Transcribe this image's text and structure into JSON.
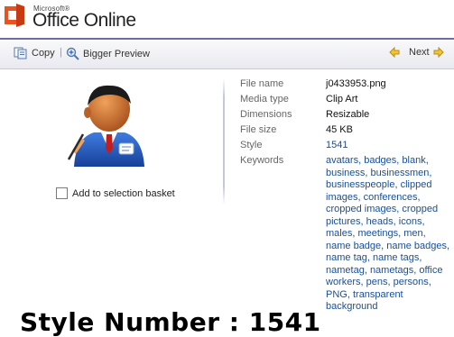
{
  "header": {
    "logo_small": "Microsoft®",
    "logo_title": "Office Online"
  },
  "toolbar": {
    "copy_label": "Copy",
    "separator": "|",
    "bigger_preview_label": "Bigger Preview",
    "next_label": "Next"
  },
  "basket": {
    "label": "Add to selection basket",
    "checked": false
  },
  "props": {
    "file_name": {
      "label": "File name",
      "value": "j0433953.png"
    },
    "media_type": {
      "label": "Media type",
      "value": "Clip Art"
    },
    "dimensions": {
      "label": "Dimensions",
      "value": "Resizable"
    },
    "file_size": {
      "label": "File size",
      "value": "45 KB"
    },
    "style": {
      "label": "Style",
      "value": "1541"
    },
    "keywords_label": "Keywords"
  },
  "keywords": [
    "avatars",
    "badges",
    "blank",
    "business",
    "businessmen",
    "businesspeople",
    "clipped images",
    "conferences",
    "cropped images",
    "cropped pictures",
    "heads",
    "icons",
    "males",
    "meetings",
    "men",
    "name badge",
    "name badges",
    "name tag",
    "name tags",
    "nametag",
    "nametags",
    "office workers",
    "pens",
    "persons",
    "PNG",
    "transparent background"
  ],
  "overlay_text": "Style Number : 1541",
  "colors": {
    "link": "#1a4f94",
    "header_rule": "#6d6d9a",
    "toolbar_bg": "#eeeff4"
  }
}
